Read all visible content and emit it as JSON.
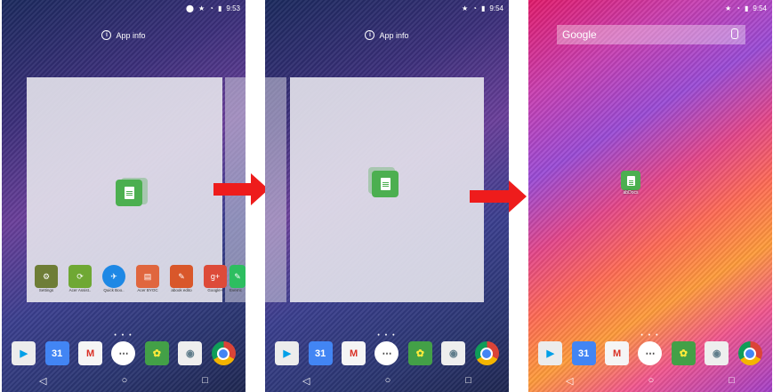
{
  "screens": [
    {
      "status": {
        "time": "9:53"
      },
      "app_info": {
        "label": "App info"
      },
      "page_indicator": "• • •",
      "dock": [
        "Play Store",
        "Calendar",
        "Gmail",
        "All apps",
        "Gallery",
        "Camera",
        "Chrome"
      ],
      "calendar_day": "31",
      "homescreen_row": [
        {
          "name": "Settings",
          "label": "Settings",
          "color": "#6e7d36",
          "glyph": "⚙"
        },
        {
          "name": "Acer Assist",
          "label": "Acer Assist..",
          "color": "#6fa834",
          "glyph": "⟳"
        },
        {
          "name": "Quick Boo",
          "label": "Quick Boo..",
          "color": "#1e88e5",
          "glyph": "✈"
        },
        {
          "name": "Acer BYOC",
          "label": "Acer BYOC",
          "color": "#e0663e",
          "glyph": "▤"
        },
        {
          "name": "abook editor",
          "label": "abook edito",
          "color": "#d9572a",
          "glyph": "✎"
        },
        {
          "name": "Google+",
          "label": "Google+",
          "color": "#dd4b39",
          "glyph": "g+"
        }
      ],
      "edge_app_label": "Evernc"
    },
    {
      "status": {
        "time": "9:54"
      },
      "app_info": {
        "label": "App info"
      },
      "page_indicator": "• • •",
      "dock": [
        "Play Store",
        "Calendar",
        "Gmail",
        "All apps",
        "Gallery",
        "Camera",
        "Chrome"
      ],
      "calendar_day": "31"
    },
    {
      "status": {
        "time": "9:54"
      },
      "search": {
        "label": "Google"
      },
      "doc_app_label": "abDocs",
      "page_indicator": "• • •",
      "dock": [
        "Play Store",
        "Calendar",
        "Gmail",
        "All apps",
        "Gallery",
        "Camera",
        "Chrome"
      ],
      "calendar_day": "31"
    }
  ],
  "nav": {
    "back": "◁",
    "home": "○",
    "recents": "□"
  },
  "colors": {
    "arrow": "#ee1c1c",
    "doc_icon": "#4caf50"
  }
}
